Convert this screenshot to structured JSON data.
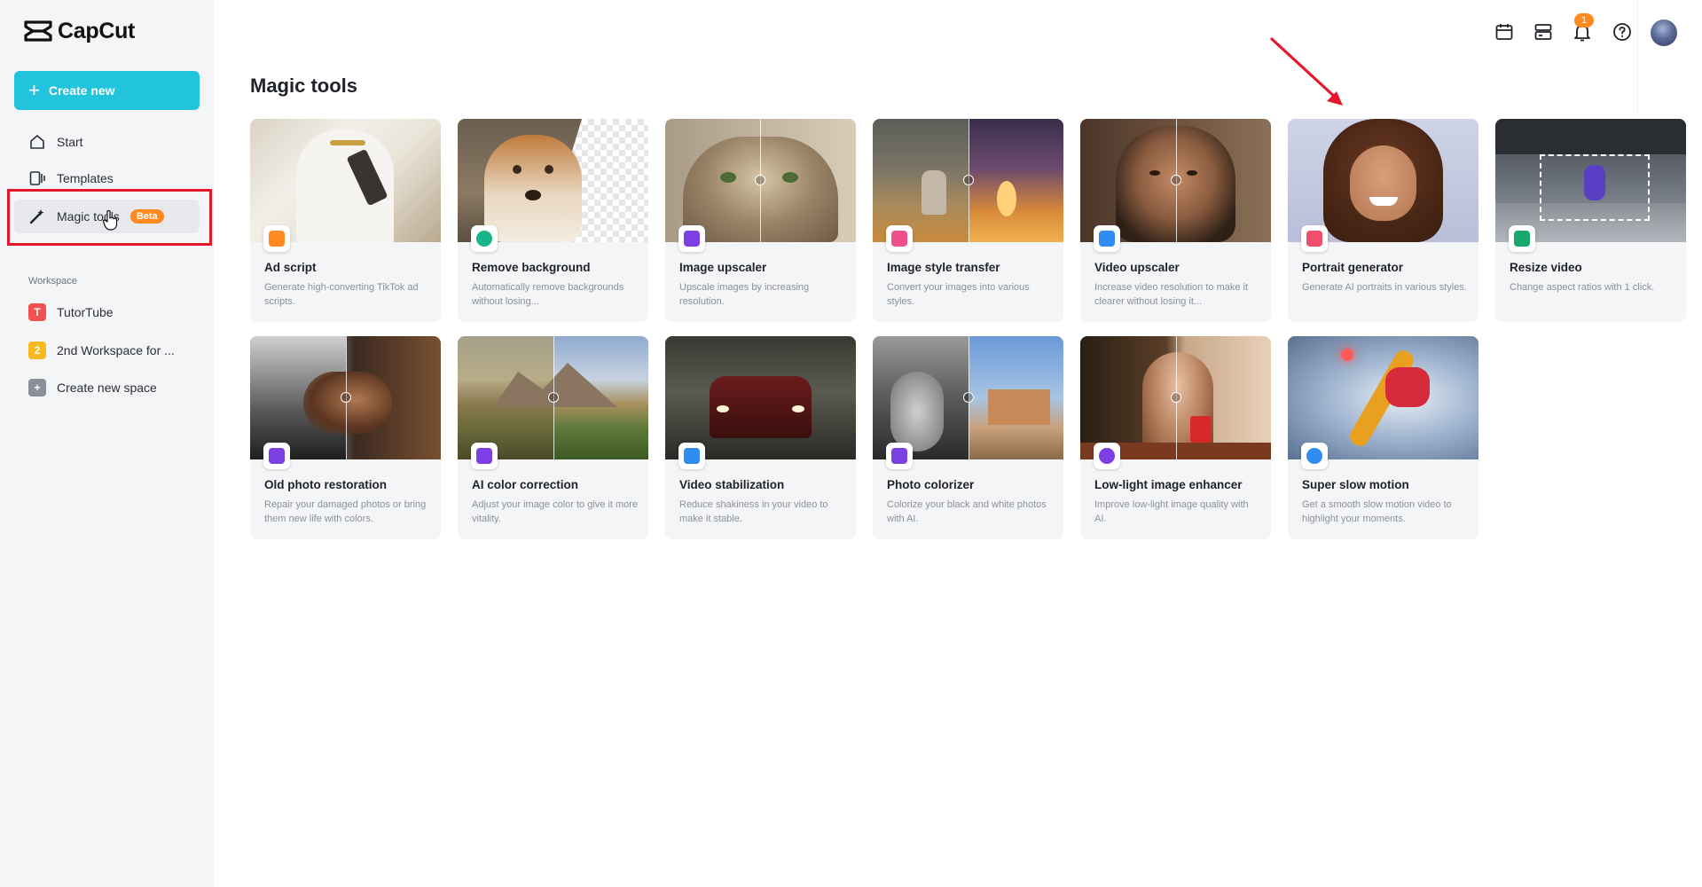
{
  "app": {
    "name": "CapCut"
  },
  "sidebar": {
    "create_label": "Create new",
    "nav": [
      {
        "label": "Start",
        "icon": "home-icon"
      },
      {
        "label": "Templates",
        "icon": "templates-icon"
      },
      {
        "label": "Magic tools",
        "icon": "magic-wand-icon",
        "badge": "Beta"
      }
    ],
    "workspace_title": "Workspace",
    "workspaces": [
      {
        "initial": "T",
        "label": "TutorTube",
        "color": "#f2524f"
      },
      {
        "initial": "2",
        "label": "2nd Workspace for ...",
        "color": "#f7b91d"
      },
      {
        "initial": "+",
        "label": "Create new space",
        "color": "#8a9099"
      }
    ]
  },
  "topbar": {
    "icons": [
      "calendar-icon",
      "storage-icon",
      "bell-icon",
      "help-icon"
    ],
    "notification_count": "1"
  },
  "page": {
    "title": "Magic tools"
  },
  "tools": [
    {
      "title": "Ad script",
      "desc": "Generate high-converting TikTok ad scripts.",
      "icon_color": "#ff8a1f"
    },
    {
      "title": "Remove background",
      "desc": "Automatically remove backgrounds without losing...",
      "icon_color": "#18b58a"
    },
    {
      "title": "Image upscaler",
      "desc": "Upscale images by increasing resolution.",
      "icon_color": "#7b3fe4"
    },
    {
      "title": "Image style transfer",
      "desc": "Convert your images into various styles.",
      "icon_color": "#ef4f8b"
    },
    {
      "title": "Video upscaler",
      "desc": "Increase video resolution to make it clearer without losing it...",
      "icon_color": "#2f8cf0"
    },
    {
      "title": "Portrait generator",
      "desc": "Generate AI portraits in various styles.",
      "icon_color": "#ef4f6b"
    },
    {
      "title": "Resize video",
      "desc": "Change aspect ratios with 1 click.",
      "icon_color": "#18a86b"
    },
    {
      "title": "Old photo restoration",
      "desc": "Repair your damaged photos or bring them new life with colors.",
      "icon_color": "#7b3fe4"
    },
    {
      "title": "AI color correction",
      "desc": "Adjust your image color to give it more vitality.",
      "icon_color": "#7b3fe4"
    },
    {
      "title": "Video stabilization",
      "desc": "Reduce shakiness in your video to make it stable.",
      "icon_color": "#2f8cf0"
    },
    {
      "title": "Photo colorizer",
      "desc": "Colorize your black and white photos with AI.",
      "icon_color": "#7b3fe4"
    },
    {
      "title": "Low-light image enhancer",
      "desc": "Improve low-light image quality with AI.",
      "icon_color": "#7b3fe4"
    },
    {
      "title": "Super slow motion",
      "desc": "Get a smooth slow motion video to highlight your moments.",
      "icon_color": "#2f8cf0"
    }
  ]
}
